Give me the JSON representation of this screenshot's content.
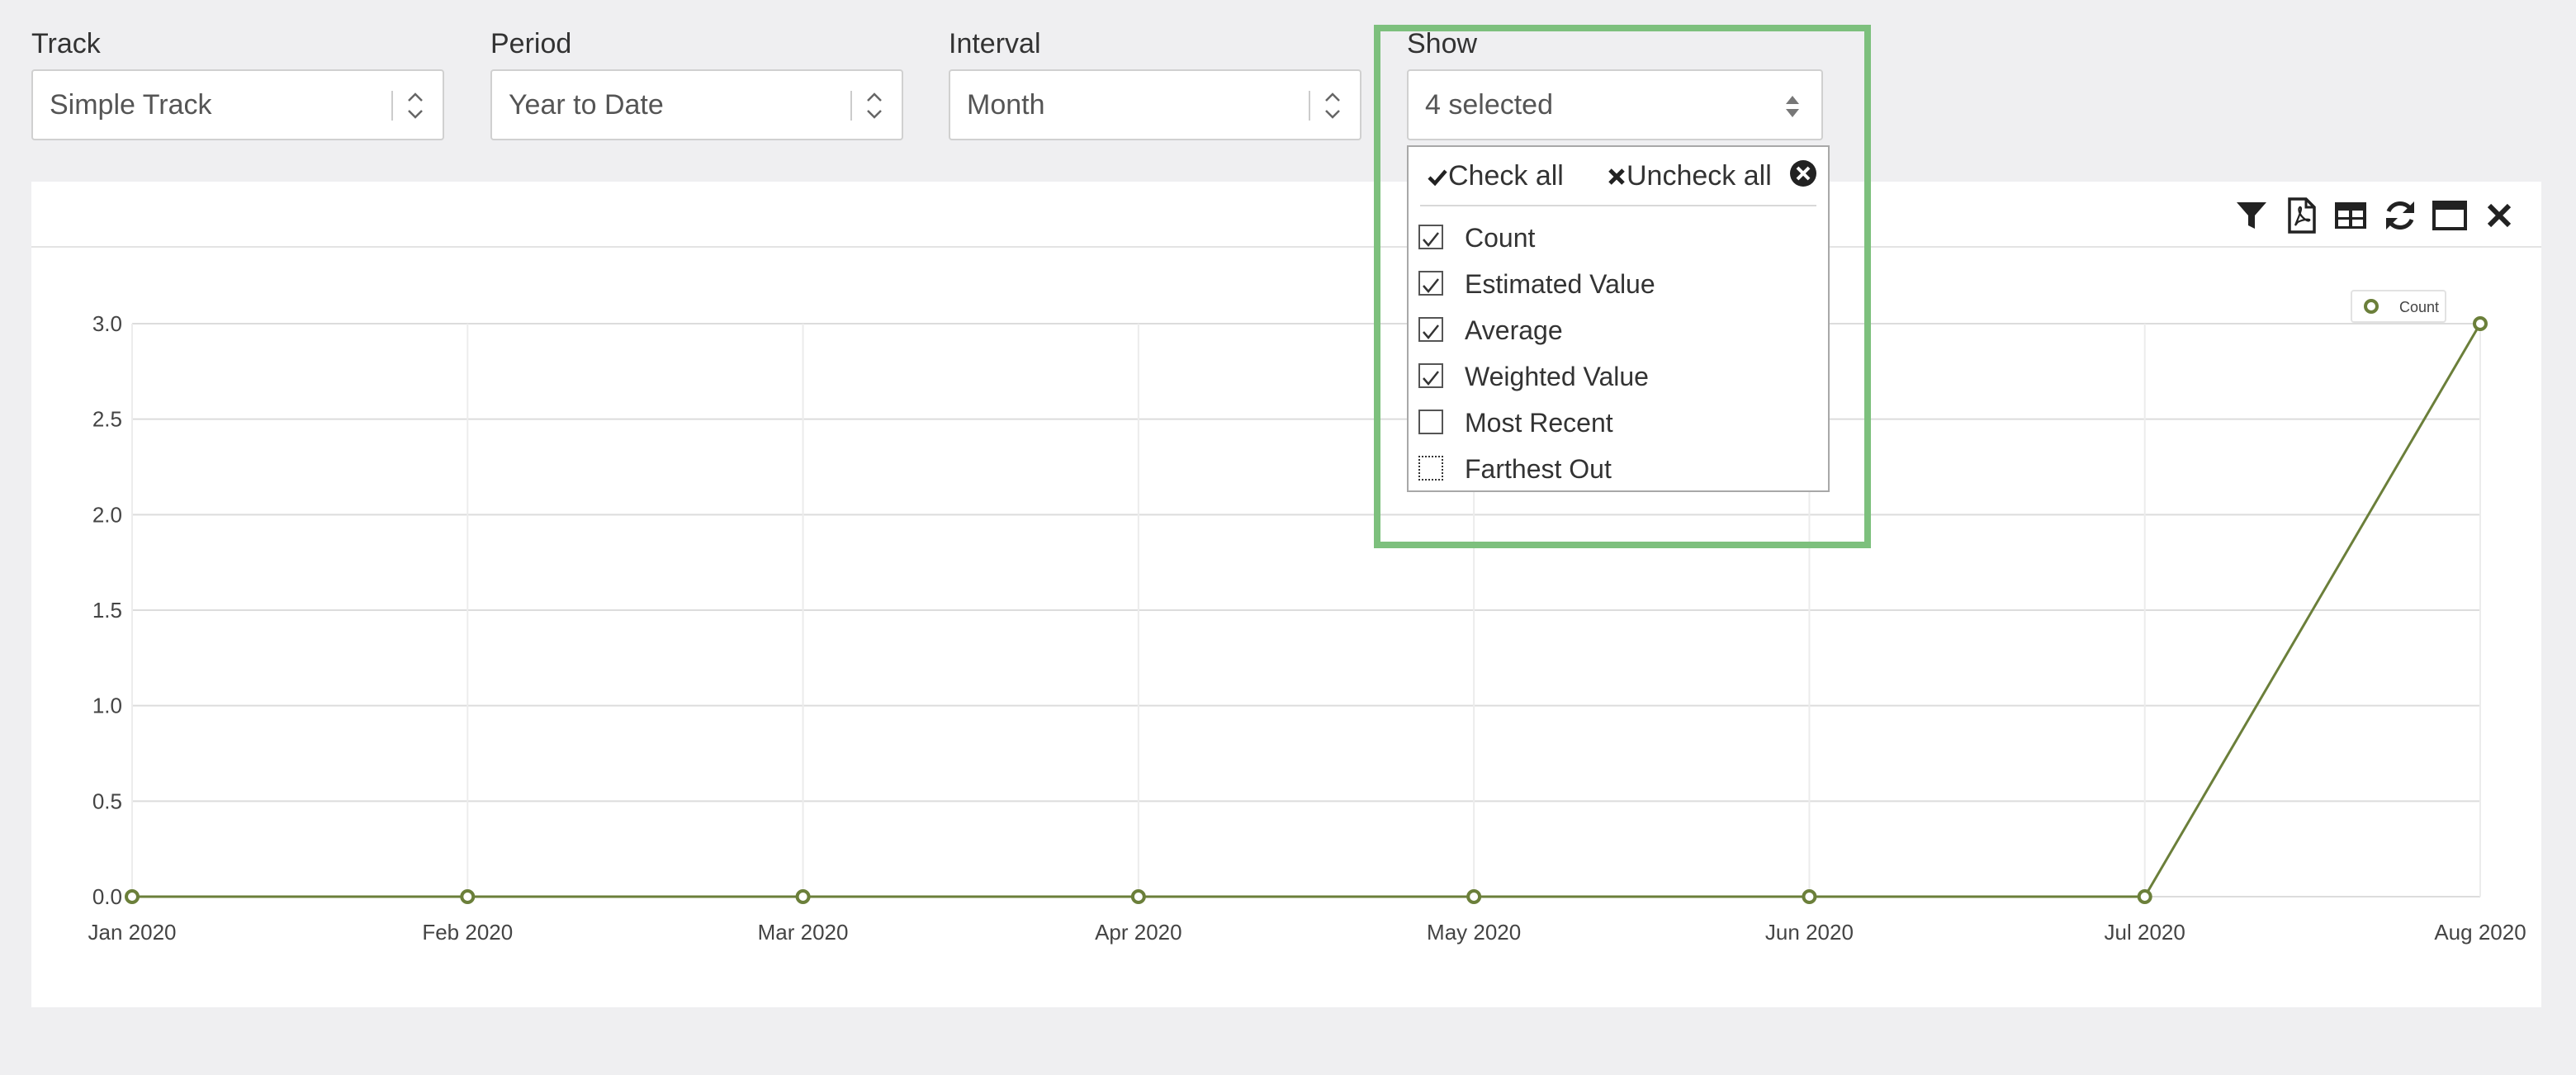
{
  "filters": {
    "track": {
      "label": "Track",
      "value": "Simple Track"
    },
    "period": {
      "label": "Period",
      "value": "Year to Date"
    },
    "interval": {
      "label": "Interval",
      "value": "Month"
    },
    "show": {
      "label": "Show",
      "value": "4 selected"
    }
  },
  "toolbar": {
    "icons": [
      "filter-icon",
      "pdf-icon",
      "table-icon",
      "refresh-icon",
      "window-icon",
      "close-icon"
    ]
  },
  "dropdown": {
    "check_all": "Check all",
    "uncheck_all": "Uncheck all",
    "options": [
      {
        "label": "Count",
        "checked": true
      },
      {
        "label": "Estimated Value",
        "checked": true
      },
      {
        "label": "Average",
        "checked": true
      },
      {
        "label": "Weighted Value",
        "checked": true
      },
      {
        "label": "Most Recent",
        "checked": false
      },
      {
        "label": "Farthest Out",
        "checked": false
      }
    ]
  },
  "colors": {
    "series": "#6b7f3a",
    "highlight": "#7dc07d"
  },
  "chart_data": {
    "type": "line",
    "categories": [
      "Jan 2020",
      "Feb 2020",
      "Mar 2020",
      "Apr 2020",
      "May 2020",
      "Jun 2020",
      "Jul 2020",
      "Aug 2020"
    ],
    "series": [
      {
        "name": "Count",
        "values": [
          0,
          0,
          0,
          0,
          0,
          0,
          0,
          3
        ]
      }
    ],
    "y_ticks": [
      "0.0",
      "0.5",
      "1.0",
      "1.5",
      "2.0",
      "2.5",
      "3.0"
    ],
    "ylim": [
      0,
      3
    ],
    "grid": true,
    "legend": "top-right"
  }
}
